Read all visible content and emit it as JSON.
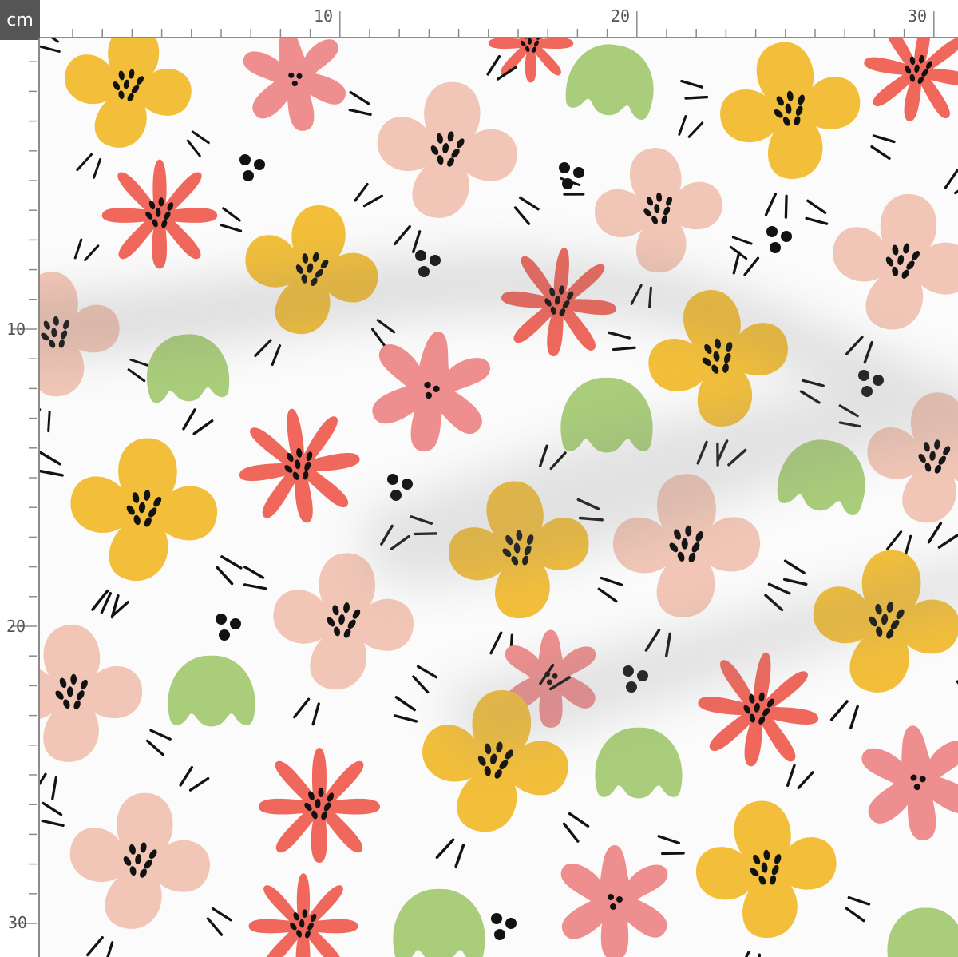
{
  "ruler": {
    "unit": "cm",
    "top_labels": [
      "10",
      "20",
      "30"
    ],
    "left_labels": [
      "10",
      "20",
      "30"
    ]
  },
  "colors": {
    "yellow": "#f3bf3a",
    "pink": "#ef8e8e",
    "peach": "#f1c6b6",
    "coral": "#f0675b",
    "green": "#a9cd7a",
    "ink": "#121212",
    "background": "#fbfbfb"
  },
  "pattern": {
    "motifs": [
      "yellow-flower",
      "pink-flower",
      "peach-flower",
      "coral-flower",
      "green-leaf",
      "dot-cluster"
    ]
  }
}
